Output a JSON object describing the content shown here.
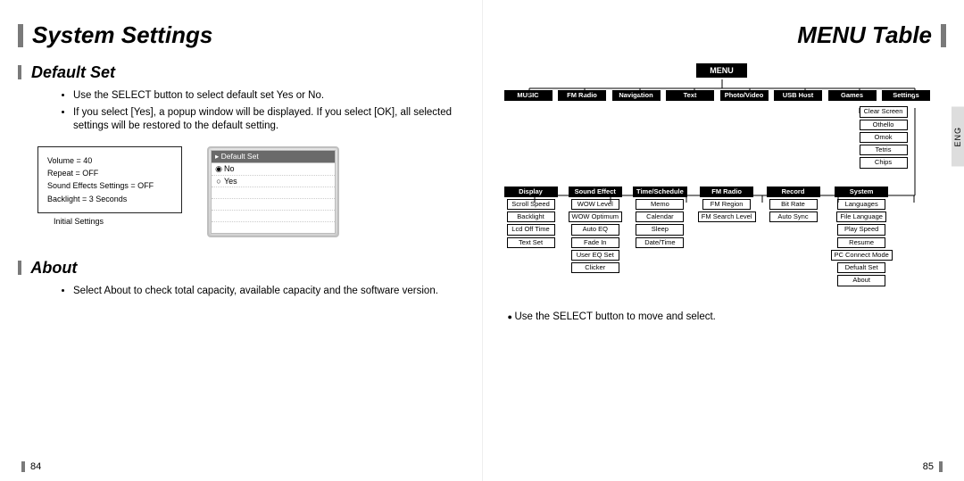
{
  "left": {
    "title": "System Settings",
    "sect1": "Default Set",
    "sect1_bullets": [
      "Use the SELECT button to select default set Yes or No.",
      "If you select [Yes], a popup window will be displayed. If you select [OK], all selected settings will be restored to the default setting."
    ],
    "init_lines": [
      "Volume = 40",
      "Repeat = OFF",
      "Sound Effects Settings = OFF",
      "Backlight = 3 Seconds"
    ],
    "init_caption": "Initial Settings",
    "lcd_header": "Default Set",
    "lcd_options": [
      "No",
      "Yes"
    ],
    "lcd_selected_index": 0,
    "sect2": "About",
    "sect2_bullets": [
      "Select About to check total capacity, available capacity and the software version."
    ],
    "page_number": "84"
  },
  "right": {
    "title": "MENU Table",
    "lang_tab": "ENG",
    "menu_root": "MENU",
    "top_menus": [
      "MUSIC",
      "FM Radio",
      "Navigation",
      "Text",
      "Photo/Video",
      "USB Host",
      "Games",
      "Settings"
    ],
    "games_items": [
      "Clear Screen",
      "Othello",
      "Omok",
      "Tetris",
      "Chips"
    ],
    "settings_groups": [
      {
        "name": "Display",
        "items": [
          "Scroll Speed",
          "Backlight",
          "Lcd Off Time",
          "Text Set"
        ]
      },
      {
        "name": "Sound Effect",
        "items": [
          "WOW Level",
          "WOW Optimum",
          "Auto EQ",
          "Fade In",
          "User EQ Set",
          "Clicker"
        ]
      },
      {
        "name": "Time/Schedule",
        "items": [
          "Memo",
          "Calendar",
          "Sleep",
          "Date/Time"
        ]
      },
      {
        "name": "FM Radio",
        "items": [
          "FM Region",
          "FM Search Level"
        ]
      },
      {
        "name": "Record",
        "items": [
          "Bit Rate",
          "Auto Sync"
        ]
      },
      {
        "name": "System",
        "items": [
          "Languages",
          "File Language",
          "Play Speed",
          "Resume",
          "PC Connect Mode",
          "Defualt Set",
          "About"
        ]
      }
    ],
    "footnote": "Use the SELECT button to move and select.",
    "page_number": "85"
  }
}
